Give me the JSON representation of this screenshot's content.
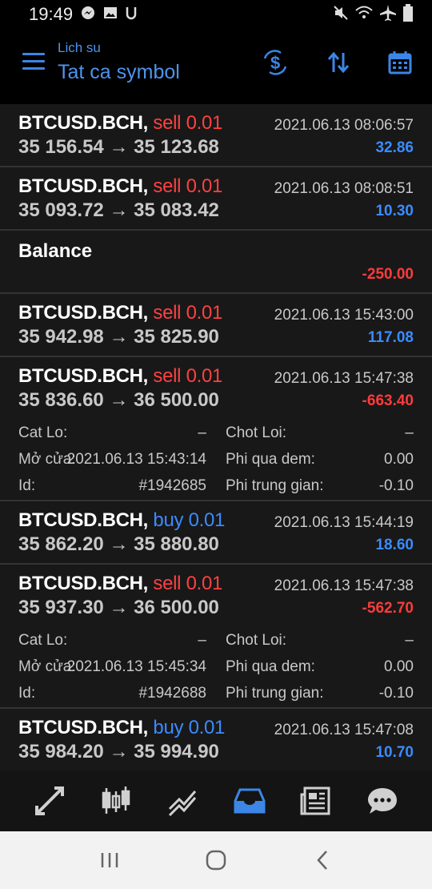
{
  "status": {
    "time": "19:49"
  },
  "header": {
    "subtitle": "Lich su",
    "title": "Tat ca symbol"
  },
  "deals": [
    {
      "symbol": "BTCUSD.BCH,",
      "side": "sell",
      "volume": "0.01",
      "open_price": "35 156.54",
      "arrow": "→",
      "close_price": "35 123.68",
      "time": "2021.06.13 08:06:57",
      "profit": "32.86"
    },
    {
      "symbol": "BTCUSD.BCH,",
      "side": "sell",
      "volume": "0.01",
      "open_price": "35 093.72",
      "arrow": "→",
      "close_price": "35 083.42",
      "time": "2021.06.13 08:08:51",
      "profit": "10.30"
    },
    {
      "balance_label": "Balance",
      "profit": "-250.00"
    },
    {
      "symbol": "BTCUSD.BCH,",
      "side": "sell",
      "volume": "0.01",
      "open_price": "35 942.98",
      "arrow": "→",
      "close_price": "35 825.90",
      "time": "2021.06.13 15:43:00",
      "profit": "117.08"
    },
    {
      "symbol": "BTCUSD.BCH,",
      "side": "sell",
      "volume": "0.01",
      "open_price": "35 836.60",
      "arrow": "→",
      "close_price": "36 500.00",
      "time": "2021.06.13 15:47:38",
      "profit": "-663.40",
      "details": {
        "sl_label": "Cat Lo:",
        "sl_value": "–",
        "tp_label": "Chot Loi:",
        "tp_value": "–",
        "open_label": "Mở cửa:",
        "open_time": "2021.06.13 15:43:14",
        "swap_label": "Phi qua dem:",
        "swap_value": "0.00",
        "id_label": "Id:",
        "id_value": "#1942685",
        "comm_label": "Phi trung gian:",
        "comm_value": "-0.10"
      }
    },
    {
      "symbol": "BTCUSD.BCH,",
      "side": "buy",
      "volume": "0.01",
      "open_price": "35 862.20",
      "arrow": "→",
      "close_price": "35 880.80",
      "time": "2021.06.13 15:44:19",
      "profit": "18.60"
    },
    {
      "symbol": "BTCUSD.BCH,",
      "side": "sell",
      "volume": "0.01",
      "open_price": "35 937.30",
      "arrow": "→",
      "close_price": "36 500.00",
      "time": "2021.06.13 15:47:38",
      "profit": "-562.70",
      "details": {
        "sl_label": "Cat Lo:",
        "sl_value": "–",
        "tp_label": "Chot Loi:",
        "tp_value": "–",
        "open_label": "Mở cửa:",
        "open_time": "2021.06.13 15:45:34",
        "swap_label": "Phi qua dem:",
        "swap_value": "0.00",
        "id_label": "Id:",
        "id_value": "#1942688",
        "comm_label": "Phi trung gian:",
        "comm_value": "-0.10"
      }
    },
    {
      "symbol": "BTCUSD.BCH,",
      "side": "buy",
      "volume": "0.01",
      "open_price": "35 984.20",
      "arrow": "→",
      "close_price": "35 994.90",
      "time": "2021.06.13 15:47:08",
      "profit": "10.70"
    }
  ],
  "colors": {
    "accent": "#3b86e6",
    "profit_positive": "#3b8bff",
    "profit_negative": "#ff3b3b",
    "sell": "#ff4040",
    "buy": "#3b8bff"
  },
  "bottom_nav": [
    {
      "icon": "quotes-arrows-icon"
    },
    {
      "icon": "chart-candles-icon"
    },
    {
      "icon": "trade-lines-icon"
    },
    {
      "icon": "history-inbox-icon",
      "active": true
    },
    {
      "icon": "news-icon"
    },
    {
      "icon": "chat-icon"
    }
  ]
}
